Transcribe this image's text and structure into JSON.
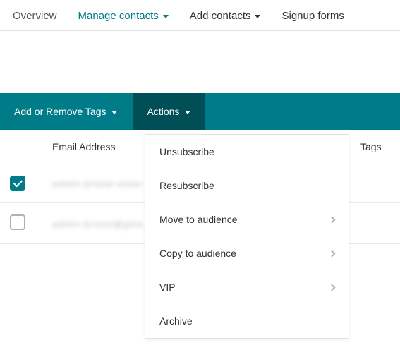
{
  "nav": {
    "overview": "Overview",
    "manage": "Manage contacts",
    "add": "Add contacts",
    "signup": "Signup forms"
  },
  "toolbar": {
    "tags_label": "Add or Remove Tags",
    "actions_label": "Actions"
  },
  "table": {
    "headers": {
      "email": "Email Address",
      "tags": "Tags"
    },
    "rows": [
      {
        "checked": true,
        "email_obscured": "admin.bristol-sister"
      },
      {
        "checked": false,
        "email_obscured": "admin.bristol@gma"
      }
    ]
  },
  "actions_menu": {
    "unsubscribe": "Unsubscribe",
    "resubscribe": "Resubscribe",
    "move": "Move to audience",
    "copy": "Copy to audience",
    "vip": "VIP",
    "archive": "Archive"
  }
}
